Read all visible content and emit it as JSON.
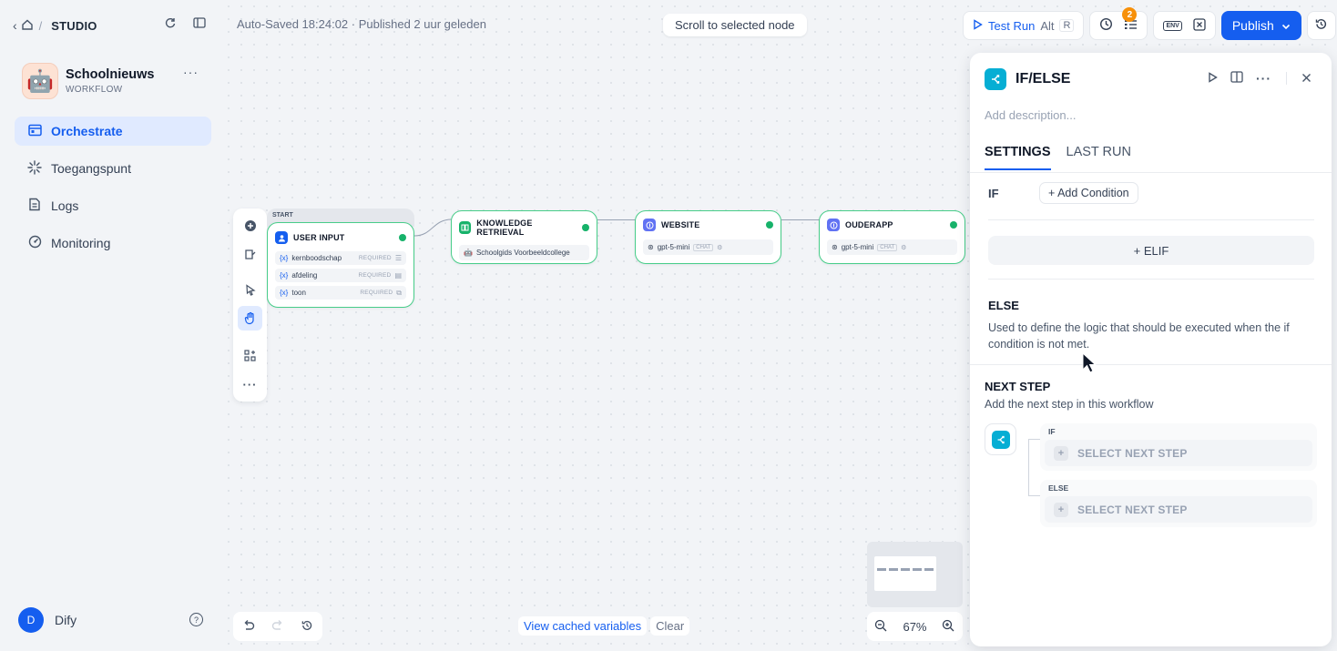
{
  "nav": {
    "studio": "STUDIO"
  },
  "app": {
    "name": "Schoolnieuws",
    "type": "WORKFLOW",
    "avatar": "🤖"
  },
  "sidebar": {
    "items": [
      {
        "label": "Orchestrate",
        "icon": "orchestrate-icon",
        "active": true
      },
      {
        "label": "Toegangspunt",
        "icon": "access-point-icon",
        "active": false
      },
      {
        "label": "Logs",
        "icon": "logs-icon",
        "active": false
      },
      {
        "label": "Monitoring",
        "icon": "monitoring-icon",
        "active": false
      }
    ]
  },
  "user": {
    "initial": "D",
    "name": "Dify"
  },
  "canvas": {
    "autosave": "Auto-Saved 18:24:02 · Published 2 uur geleden",
    "scroll_button": "Scroll to selected node",
    "test_run": {
      "label": "Test Run",
      "shortcut_alt": "Alt",
      "shortcut_key": "R"
    },
    "checklist_badge": "2",
    "env_label": "ENV",
    "publish_label": "Publish",
    "start_tag": "START",
    "nodes": {
      "user_input": {
        "title": "USER INPUT",
        "vars": [
          {
            "name": "kernboodschap",
            "req": "REQUIRED"
          },
          {
            "name": "afdeling",
            "req": "REQUIRED"
          },
          {
            "name": "toon",
            "req": "REQUIRED"
          }
        ]
      },
      "knowledge": {
        "title": "KNOWLEDGE RETRIEVAL",
        "row": "Schoolgids Voorbeeldcollege"
      },
      "website": {
        "title": "WEBSITE",
        "model": "gpt-5-mini",
        "tag": "CHAT"
      },
      "ouderapp": {
        "title": "OUDERAPP",
        "model": "gpt-5-mini",
        "tag": "CHAT"
      }
    },
    "var_prefix": "{x}",
    "cached_vars": "View cached variables",
    "clear": "Clear",
    "zoom": "67%",
    "colors": {
      "accent": "#155eef",
      "node_border": "#47cd89",
      "ifelse": "#06aed4"
    }
  },
  "panel": {
    "title": "IF/ELSE",
    "description_placeholder": "Add description...",
    "tabs": [
      "SETTINGS",
      "LAST RUN"
    ],
    "if_label": "IF",
    "add_condition": "+ Add Condition",
    "elif": "+ ELIF",
    "else_title": "ELSE",
    "else_desc": "Used to define the logic that should be executed when the if condition is not met.",
    "next_step_title": "NEXT STEP",
    "next_step_desc": "Add the next step in this workflow",
    "branches": [
      {
        "label": "IF",
        "select": "SELECT NEXT STEP"
      },
      {
        "label": "ELSE",
        "select": "SELECT NEXT STEP"
      }
    ]
  }
}
